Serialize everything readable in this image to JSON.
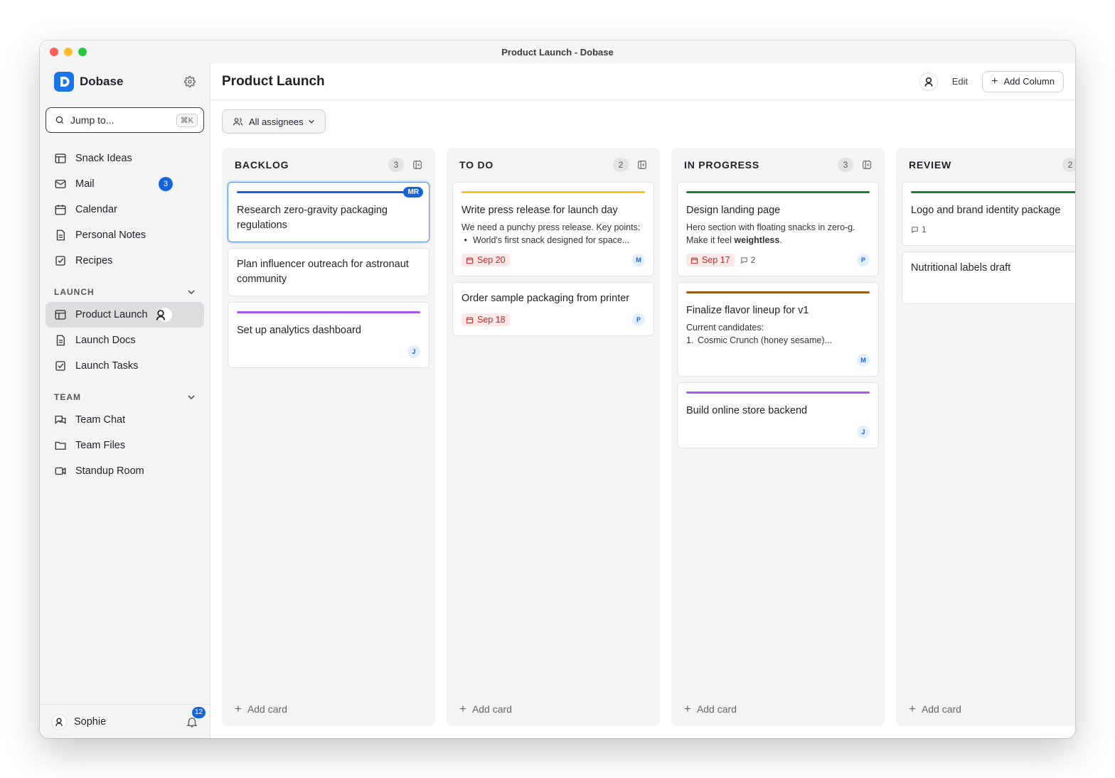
{
  "window": {
    "title": "Product Launch - Dobase"
  },
  "brand": {
    "name": "Dobase"
  },
  "search": {
    "placeholder": "Jump to...",
    "shortcut": "⌘K"
  },
  "nav": {
    "items": [
      {
        "label": "Snack Ideas",
        "icon": "table-icon"
      },
      {
        "label": "Mail",
        "icon": "mail-icon",
        "badge": "3"
      },
      {
        "label": "Calendar",
        "icon": "calendar-icon"
      },
      {
        "label": "Personal Notes",
        "icon": "document-icon"
      },
      {
        "label": "Recipes",
        "icon": "checkbox-icon"
      }
    ],
    "launch_section": "LAUNCH",
    "launch_items": [
      {
        "label": "Product Launch",
        "icon": "table-icon",
        "active": true
      },
      {
        "label": "Launch Docs",
        "icon": "document-icon"
      },
      {
        "label": "Launch Tasks",
        "icon": "checkbox-icon"
      }
    ],
    "team_section": "TEAM",
    "team_items": [
      {
        "label": "Team Chat",
        "icon": "chat-icon"
      },
      {
        "label": "Team Files",
        "icon": "folder-icon"
      },
      {
        "label": "Standup Room",
        "icon": "video-icon"
      }
    ]
  },
  "user": {
    "name": "Sophie",
    "notifications": "12"
  },
  "header": {
    "title": "Product Launch",
    "edit": "Edit",
    "add_column": "Add Column"
  },
  "filter": {
    "label": "All assignees"
  },
  "add_card_label": "Add card",
  "colors": {
    "accent": "#1565d8",
    "due": "#c62828",
    "due_bg": "#fde8e8"
  },
  "columns": [
    {
      "title": "BACKLOG",
      "count": "3",
      "cards": [
        {
          "title": "Research zero-gravity packaging regulations",
          "bar": "#1565d8",
          "badge": "MR",
          "selected": true
        },
        {
          "title": "Plan influencer outreach for astronaut community"
        },
        {
          "title": "Set up analytics dashboard",
          "bar": "#a855f7",
          "assignee": "J"
        }
      ]
    },
    {
      "title": "TO DO",
      "count": "2",
      "cards": [
        {
          "title": "Write press release for launch day",
          "bar": "#f5c518",
          "desc": "We need a punchy press release. Key points:",
          "bullet": "World's first snack designed for space...",
          "due": "Sep 20",
          "assignee": "M"
        },
        {
          "title": "Order sample packaging from printer",
          "due": "Sep 18",
          "assignee": "P"
        }
      ]
    },
    {
      "title": "IN PROGRESS",
      "count": "3",
      "cards": [
        {
          "title": "Design landing page",
          "bar": "#1a7f37",
          "desc": "Hero section with floating snacks in zero-g.",
          "desc2_pre": "Make it feel ",
          "desc2_bold": "weightless",
          "desc2_post": ".",
          "due": "Sep 17",
          "comments": "2",
          "assignee": "P"
        },
        {
          "title": "Finalize flavor lineup for v1",
          "bar": "#9a5b13",
          "desc": "Current candidates:",
          "bullet": "Cosmic Crunch (honey sesame)...",
          "bullet_marker": "1.",
          "assignee": "M"
        },
        {
          "title": "Build online store backend",
          "bar": "#a855f7",
          "assignee": "J"
        }
      ]
    },
    {
      "title": "REVIEW",
      "count": "2",
      "cards": [
        {
          "title": "Logo and brand identity package",
          "bar": "#1a7f37",
          "comments": "1"
        },
        {
          "title": "Nutritional labels draft"
        }
      ]
    }
  ]
}
